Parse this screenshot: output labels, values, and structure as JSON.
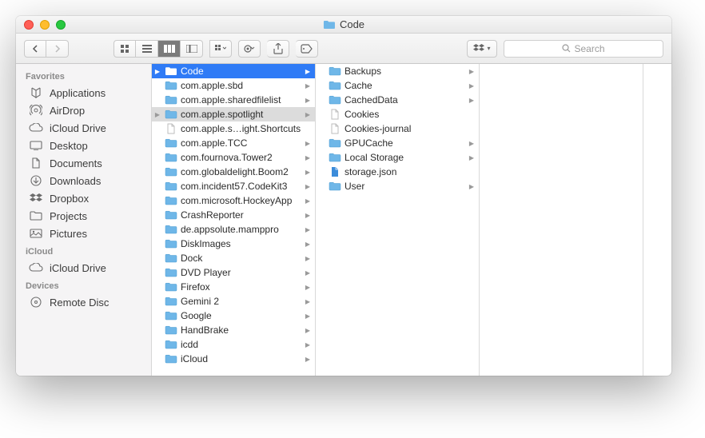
{
  "window": {
    "title": "Code"
  },
  "search": {
    "placeholder": "Search"
  },
  "sidebar": {
    "sections": [
      {
        "label": "Favorites",
        "items": [
          {
            "icon": "applications",
            "label": "Applications"
          },
          {
            "icon": "airdrop",
            "label": "AirDrop"
          },
          {
            "icon": "cloud",
            "label": "iCloud Drive"
          },
          {
            "icon": "desktop",
            "label": "Desktop"
          },
          {
            "icon": "documents",
            "label": "Documents"
          },
          {
            "icon": "downloads",
            "label": "Downloads"
          },
          {
            "icon": "dropbox",
            "label": "Dropbox"
          },
          {
            "icon": "folder",
            "label": "Projects"
          },
          {
            "icon": "pictures",
            "label": "Pictures"
          }
        ]
      },
      {
        "label": "iCloud",
        "items": [
          {
            "icon": "cloud",
            "label": "iCloud Drive"
          }
        ]
      },
      {
        "label": "Devices",
        "items": [
          {
            "icon": "disc",
            "label": "Remote Disc"
          }
        ]
      }
    ]
  },
  "columns": [
    {
      "items": [
        {
          "label": "Code",
          "type": "folder",
          "children": true,
          "selected": true
        },
        {
          "label": "com.apple.sbd",
          "type": "folder",
          "children": true
        },
        {
          "label": "com.apple.sharedfilelist",
          "type": "folder",
          "children": true
        },
        {
          "label": "com.apple.spotlight",
          "type": "folder",
          "children": true,
          "highlight": true
        },
        {
          "label": "com.apple.s…ight.Shortcuts",
          "type": "file",
          "children": false
        },
        {
          "label": "com.apple.TCC",
          "type": "folder",
          "children": true
        },
        {
          "label": "com.fournova.Tower2",
          "type": "folder",
          "children": true
        },
        {
          "label": "com.globaldelight.Boom2",
          "type": "folder",
          "children": true
        },
        {
          "label": "com.incident57.CodeKit3",
          "type": "folder",
          "children": true
        },
        {
          "label": "com.microsoft.HockeyApp",
          "type": "folder",
          "children": true
        },
        {
          "label": "CrashReporter",
          "type": "folder",
          "children": true
        },
        {
          "label": "de.appsolute.mamppro",
          "type": "folder",
          "children": true
        },
        {
          "label": "DiskImages",
          "type": "folder",
          "children": true
        },
        {
          "label": "Dock",
          "type": "folder",
          "children": true
        },
        {
          "label": "DVD Player",
          "type": "folder",
          "children": true
        },
        {
          "label": "Firefox",
          "type": "folder",
          "children": true
        },
        {
          "label": "Gemini 2",
          "type": "folder",
          "children": true
        },
        {
          "label": "Google",
          "type": "folder",
          "children": true
        },
        {
          "label": "HandBrake",
          "type": "folder",
          "children": true
        },
        {
          "label": "icdd",
          "type": "folder",
          "children": true
        },
        {
          "label": "iCloud",
          "type": "folder",
          "children": true
        }
      ]
    },
    {
      "items": [
        {
          "label": "Backups",
          "type": "folder",
          "children": true
        },
        {
          "label": "Cache",
          "type": "folder",
          "children": true
        },
        {
          "label": "CachedData",
          "type": "folder",
          "children": true
        },
        {
          "label": "Cookies",
          "type": "file",
          "children": false
        },
        {
          "label": "Cookies-journal",
          "type": "file",
          "children": false
        },
        {
          "label": "GPUCache",
          "type": "folder",
          "children": true
        },
        {
          "label": "Local Storage",
          "type": "folder",
          "children": true
        },
        {
          "label": "storage.json",
          "type": "json",
          "children": false
        },
        {
          "label": "User",
          "type": "folder",
          "children": true
        }
      ]
    },
    {
      "items": []
    }
  ]
}
